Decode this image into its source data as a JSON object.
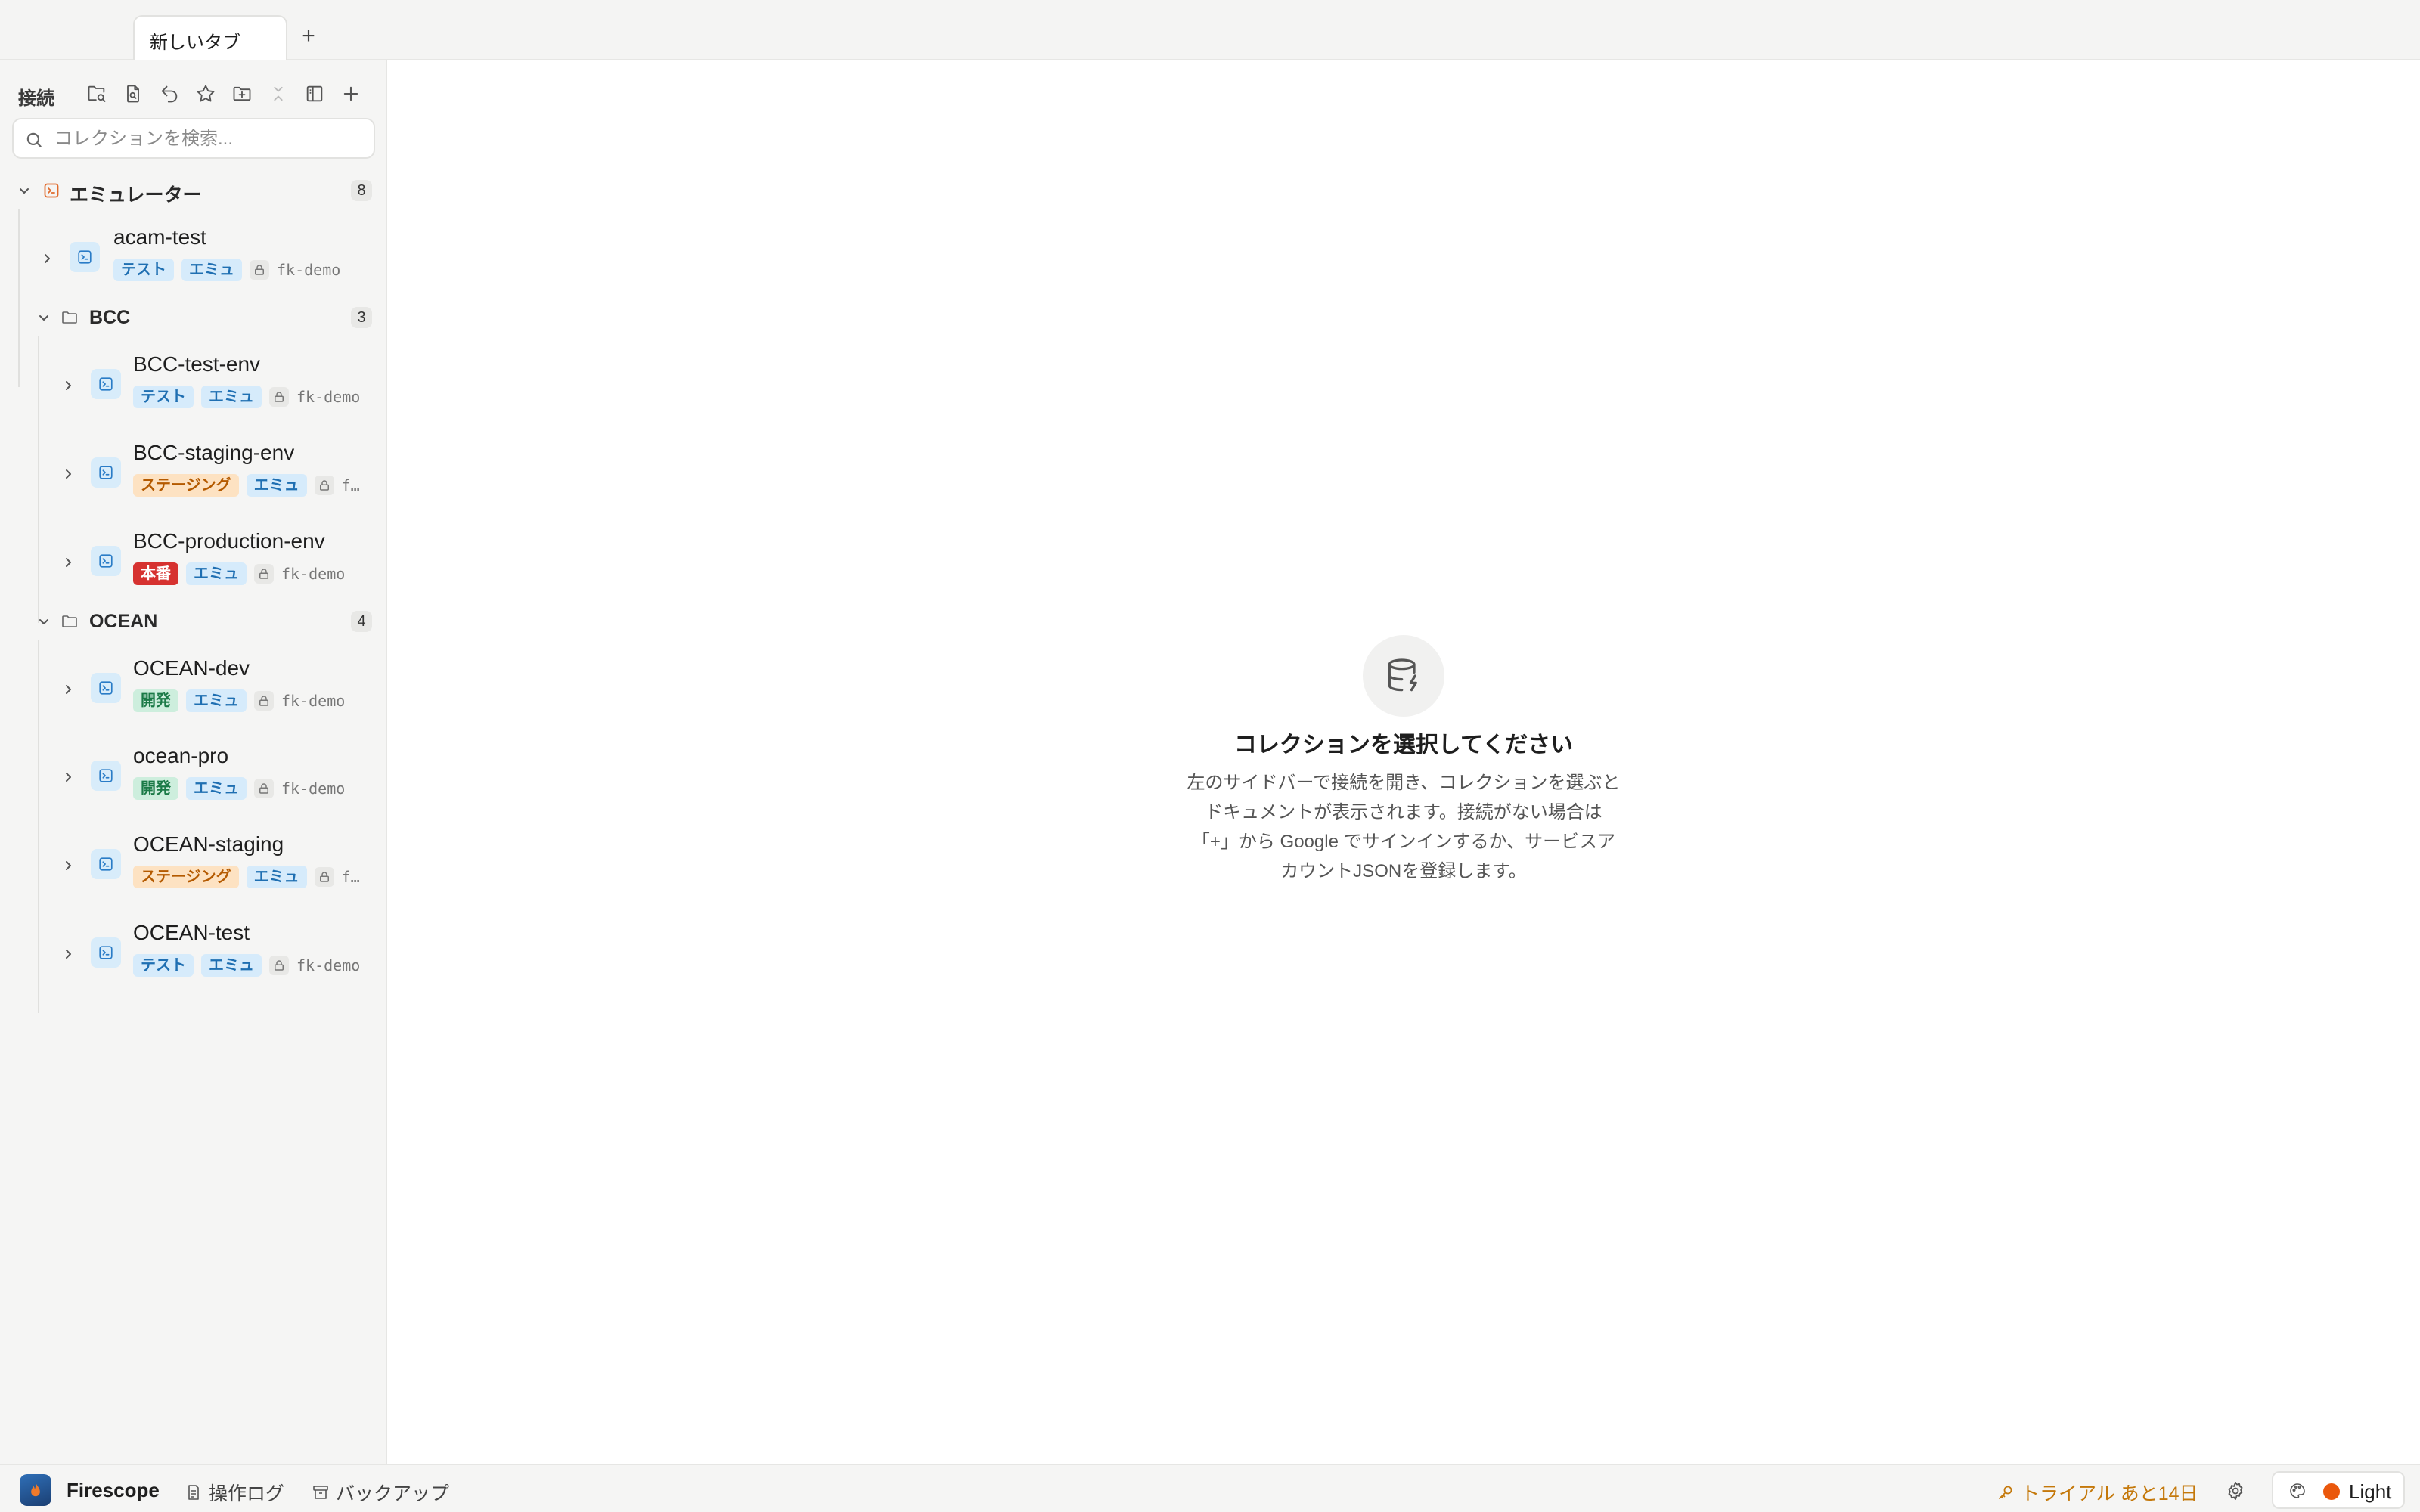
{
  "tabs": [
    {
      "label": "新しいタブ"
    }
  ],
  "tab_add": "+",
  "sidebar": {
    "title": "接続",
    "toolbar_icons": [
      "folder-search-icon",
      "file-search-icon",
      "undo-icon",
      "star-icon",
      "folder-plus-icon",
      "collapse-icon",
      "panel-icon",
      "plus-icon"
    ],
    "search_placeholder": "コレクションを検索...",
    "groups": [
      {
        "name": "エミュレーター",
        "count": "8",
        "icon": "emulator-icon",
        "connections": [
          {
            "name": "acam-test",
            "tags": [
              {
                "label": "テスト",
                "kind": "test"
              },
              {
                "label": "エミュ",
                "kind": "emu"
              }
            ],
            "project": "fk-demo"
          }
        ]
      },
      {
        "name": "BCC",
        "count": "3",
        "icon": "folder-icon",
        "connections": [
          {
            "name": "BCC-test-env",
            "tags": [
              {
                "label": "テスト",
                "kind": "test"
              },
              {
                "label": "エミュ",
                "kind": "emu"
              }
            ],
            "project": "fk-demo"
          },
          {
            "name": "BCC-staging-env",
            "tags": [
              {
                "label": "ステージング",
                "kind": "stg"
              },
              {
                "label": "エミュ",
                "kind": "emu"
              }
            ],
            "project": "f…"
          },
          {
            "name": "BCC-production-env",
            "tags": [
              {
                "label": "本番",
                "kind": "prod"
              },
              {
                "label": "エミュ",
                "kind": "emu"
              }
            ],
            "project": "fk-demo"
          }
        ]
      },
      {
        "name": "OCEAN",
        "count": "4",
        "icon": "folder-icon",
        "connections": [
          {
            "name": "OCEAN-dev",
            "tags": [
              {
                "label": "開発",
                "kind": "dev"
              },
              {
                "label": "エミュ",
                "kind": "emu"
              }
            ],
            "project": "fk-demo"
          },
          {
            "name": "ocean-pro",
            "tags": [
              {
                "label": "開発",
                "kind": "dev"
              },
              {
                "label": "エミュ",
                "kind": "emu"
              }
            ],
            "project": "fk-demo"
          },
          {
            "name": "OCEAN-staging",
            "tags": [
              {
                "label": "ステージング",
                "kind": "stg"
              },
              {
                "label": "エミュ",
                "kind": "emu"
              }
            ],
            "project": "f…"
          },
          {
            "name": "OCEAN-test",
            "tags": [
              {
                "label": "テスト",
                "kind": "test"
              },
              {
                "label": "エミュ",
                "kind": "emu"
              }
            ],
            "project": "fk-demo"
          }
        ]
      }
    ]
  },
  "main": {
    "empty_icon": "database-bolt-icon",
    "empty_title": "コレクションを選択してください",
    "empty_desc_lines": [
      "左のサイドバーで接続を開き、コレクションを選ぶと",
      "ドキュメントが表示されます。接続がない場合は",
      "「+」から Google でサインインするか、サービスア",
      "カウントJSONを登録します。"
    ]
  },
  "statusbar": {
    "app_name": "Firescope",
    "oplog_label": "操作ログ",
    "backup_label": "バックアップ",
    "trial_label": "トライアル あと14日",
    "theme_label": "Light"
  },
  "colors": {
    "accent_orange": "#ea580c",
    "trial_text": "#c4780a",
    "tag_test": "#1f6fb2",
    "tag_staging": "#b45a00",
    "tag_prod": "#d63230",
    "tag_dev": "#1b7a47"
  }
}
